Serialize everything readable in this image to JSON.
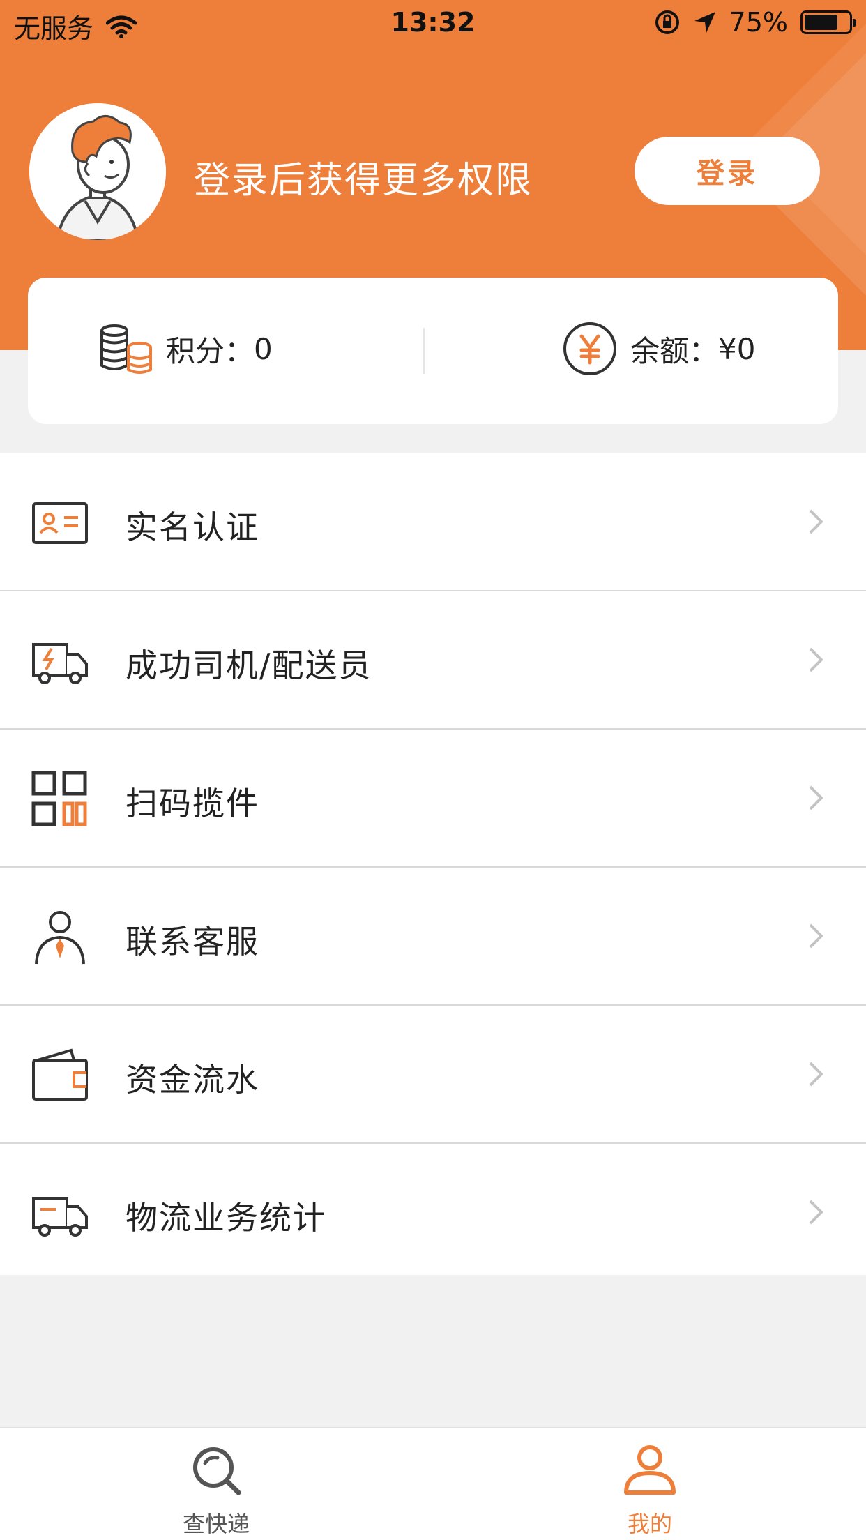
{
  "status_bar": {
    "carrier": "无服务",
    "time": "13:32",
    "battery": "75%",
    "battery_level": 0.75
  },
  "profile": {
    "login_tip": "登录后获得更多权限",
    "login_button": "登录"
  },
  "wallet": {
    "points_label": "积分：",
    "points_value": "0",
    "balance_label": "余额：",
    "balance_value": "¥0"
  },
  "menu": [
    {
      "label": "实名认证",
      "icon": "id-card-icon"
    },
    {
      "label": "成功司机/配送员",
      "icon": "delivery-truck-icon"
    },
    {
      "label": "扫码揽件",
      "icon": "qr-code-icon"
    },
    {
      "label": "联系客服",
      "icon": "customer-service-icon"
    },
    {
      "label": "资金流水",
      "icon": "wallet-icon"
    },
    {
      "label": "物流业务统计",
      "icon": "truck-icon"
    }
  ],
  "tabs": [
    {
      "label": "查快递",
      "icon": "search-icon",
      "active": false
    },
    {
      "label": "我的",
      "icon": "user-icon",
      "active": true
    }
  ],
  "colors": {
    "accent": "#ee7f3b",
    "inactive_tab": "#555555"
  }
}
